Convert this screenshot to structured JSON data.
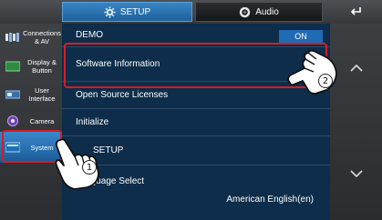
{
  "tabs": [
    {
      "label": "SETUP",
      "icon": "gear-icon",
      "active": true
    },
    {
      "label": "Audio",
      "icon": "speaker-icon",
      "active": false
    }
  ],
  "back_icon": "back-arrow-icon",
  "sidebar": {
    "items": [
      {
        "label": "Connections & AV",
        "icon": "connections-icon"
      },
      {
        "label": "Display & Button",
        "icon": "display-icon"
      },
      {
        "label": "User Interface",
        "icon": "user-interface-icon"
      },
      {
        "label": "Camera",
        "icon": "camera-icon"
      },
      {
        "label": "System",
        "icon": "system-icon",
        "active": true
      }
    ]
  },
  "list": {
    "demo": {
      "label": "DEMO",
      "value": "ON"
    },
    "rows": [
      {
        "label": "Software Information"
      },
      {
        "label": "Open Source Licenses"
      },
      {
        "label": "Initialize"
      },
      {
        "label": "SETUP"
      },
      {
        "label": "Language Select",
        "value": "American English(en)"
      }
    ]
  },
  "scroll": {
    "up_icon": "chevron-up-icon",
    "down_icon": "chevron-down-icon"
  },
  "callouts": {
    "one": "1",
    "two": "2"
  },
  "colors": {
    "accent": "#1f6bb4",
    "highlight": "#d81c24",
    "list_bg": "#0d2d4a"
  }
}
